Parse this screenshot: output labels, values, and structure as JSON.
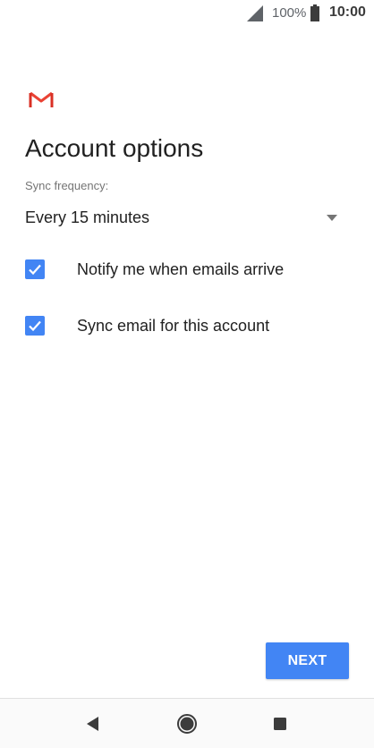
{
  "status_bar": {
    "battery_percent": "100%",
    "time": "10:00",
    "icons": [
      "signal-icon",
      "battery-icon"
    ]
  },
  "app": {
    "logo_icon": "gmail-logo-icon",
    "brand_colors": [
      "#d93025",
      "#ea4335"
    ]
  },
  "main": {
    "title": "Account options",
    "sync_label": "Sync frequency:",
    "sync_value": "Every 15 minutes",
    "options": [
      {
        "label": "Notify me when emails arrive",
        "checked": true
      },
      {
        "label": "Sync email for this account",
        "checked": true
      }
    ]
  },
  "footer": {
    "next_label": "NEXT",
    "accent_color": "#4285f4"
  },
  "nav_bar": {
    "icons": [
      "back-icon",
      "home-icon",
      "recents-icon"
    ]
  }
}
